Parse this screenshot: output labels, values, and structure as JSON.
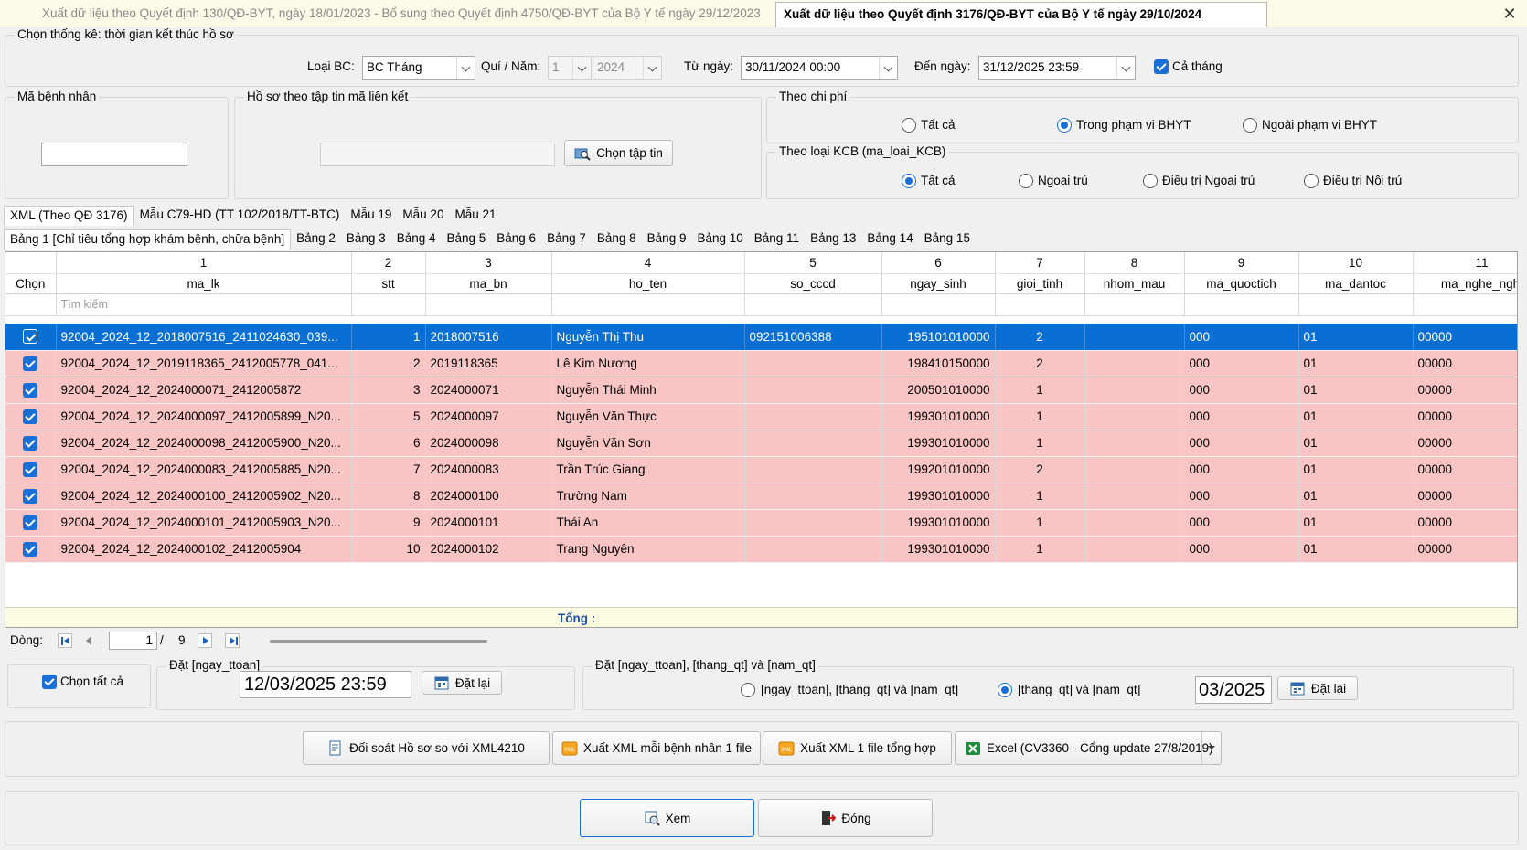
{
  "tabs": {
    "inactive": "Xuất dữ liệu theo Quyết định 130/QĐ-BYT, ngày 18/01/2023 - Bổ sung theo Quyết định 4750/QĐ-BYT của Bộ Y tế ngày 29/12/2023",
    "active": "Xuất dữ liệu theo Quyết định 3176/QĐ-BYT của Bộ Y tế ngày 29/10/2024"
  },
  "filter": {
    "group_label": "Chọn thống kê: thời gian kết thúc hồ sơ",
    "loai_bc_label": "Loại BC:",
    "loai_bc_value": "BC Tháng",
    "quy_nam_label": "Quí / Năm:",
    "quy_value": "1",
    "nam_value": "2024",
    "tu_ngay_label": "Từ ngày:",
    "tu_ngay_value": "30/11/2024 00:00",
    "den_ngay_label": "Đến ngày:",
    "den_ngay_value": "31/12/2025 23:59",
    "ca_thang_label": "Cả tháng"
  },
  "patient": {
    "label": "Mã bệnh nhân",
    "value": ""
  },
  "file_link": {
    "label": "Hồ sơ theo tập tin mã liên kết",
    "button": "Chọn tập tin"
  },
  "cost": {
    "label": "Theo chi phí",
    "options": [
      "Tất cả",
      "Trong phạm vi BHYT",
      "Ngoài phạm vi BHYT"
    ],
    "selected": 1
  },
  "kcb": {
    "label": "Theo loại KCB (ma_loai_KCB)",
    "options": [
      "Tất cả",
      "Ngoại trú",
      "Điều trị Ngoại trú",
      "Điều trị Nội trú"
    ],
    "selected": 0
  },
  "format_tabs": [
    "XML (Theo QĐ 3176)",
    "Mẫu C79-HD (TT 102/2018/TT-BTC)",
    "Mẫu 19",
    "Mẫu 20",
    "Mẫu 21"
  ],
  "table_tabs": [
    "Bảng 1 [Chỉ tiêu tổng hợp khám bệnh, chữa bệnh]",
    "Bảng 2",
    "Bảng 3",
    "Bảng 4",
    "Bảng 5",
    "Bảng 6",
    "Bảng 7",
    "Bảng 8",
    "Bảng 9",
    "Bảng 10",
    "Bảng 11",
    "Bảng 13",
    "Bảng 14",
    "Bảng 15"
  ],
  "grid": {
    "col_numbers": [
      "",
      "1",
      "2",
      "3",
      "4",
      "5",
      "6",
      "7",
      "8",
      "9",
      "10",
      "11"
    ],
    "col_names": [
      "Chọn",
      "ma_lk",
      "stt",
      "ma_bn",
      "ho_ten",
      "so_cccd",
      "ngay_sinh",
      "gioi_tinh",
      "nhom_mau",
      "ma_quoctich",
      "ma_dantoc",
      "ma_nghe_nghi"
    ],
    "search_placeholder": "Tìm kiếm",
    "rows": [
      {
        "ma_lk": "92004_2024_12_2018007516_2411024630_039...",
        "stt": "1",
        "ma_bn": "2018007516",
        "ho_ten": "Nguyễn Thị Thu",
        "so_cccd": "092151006388",
        "ngay_sinh": "195101010000",
        "gioi_tinh": "2",
        "nhom_mau": "",
        "ma_quoctich": "000",
        "ma_dantoc": "01",
        "ma_nghe": "00000"
      },
      {
        "ma_lk": "92004_2024_12_2019118365_2412005778_041...",
        "stt": "2",
        "ma_bn": "2019118365",
        "ho_ten": "Lê Kim Nương",
        "so_cccd": "",
        "ngay_sinh": "198410150000",
        "gioi_tinh": "2",
        "nhom_mau": "",
        "ma_quoctich": "000",
        "ma_dantoc": "01",
        "ma_nghe": "00000"
      },
      {
        "ma_lk": "92004_2024_12_2024000071_2412005872",
        "stt": "3",
        "ma_bn": "2024000071",
        "ho_ten": "Nguyễn Thái Minh",
        "so_cccd": "",
        "ngay_sinh": "200501010000",
        "gioi_tinh": "1",
        "nhom_mau": "",
        "ma_quoctich": "000",
        "ma_dantoc": "01",
        "ma_nghe": "00000"
      },
      {
        "ma_lk": "92004_2024_12_2024000097_2412005899_N20...",
        "stt": "5",
        "ma_bn": "2024000097",
        "ho_ten": "Nguyễn Văn Thực",
        "so_cccd": "",
        "ngay_sinh": "199301010000",
        "gioi_tinh": "1",
        "nhom_mau": "",
        "ma_quoctich": "000",
        "ma_dantoc": "01",
        "ma_nghe": "00000"
      },
      {
        "ma_lk": "92004_2024_12_2024000098_2412005900_N20...",
        "stt": "6",
        "ma_bn": "2024000098",
        "ho_ten": "Nguyễn Văn Sơn",
        "so_cccd": "",
        "ngay_sinh": "199301010000",
        "gioi_tinh": "1",
        "nhom_mau": "",
        "ma_quoctich": "000",
        "ma_dantoc": "01",
        "ma_nghe": "00000"
      },
      {
        "ma_lk": "92004_2024_12_2024000083_2412005885_N20...",
        "stt": "7",
        "ma_bn": "2024000083",
        "ho_ten": "Trần Trúc Giang",
        "so_cccd": "",
        "ngay_sinh": "199201010000",
        "gioi_tinh": "2",
        "nhom_mau": "",
        "ma_quoctich": "000",
        "ma_dantoc": "01",
        "ma_nghe": "00000"
      },
      {
        "ma_lk": "92004_2024_12_2024000100_2412005902_N20...",
        "stt": "8",
        "ma_bn": "2024000100",
        "ho_ten": "Trường Nam",
        "so_cccd": "",
        "ngay_sinh": "199301010000",
        "gioi_tinh": "1",
        "nhom_mau": "",
        "ma_quoctich": "000",
        "ma_dantoc": "01",
        "ma_nghe": "00000"
      },
      {
        "ma_lk": "92004_2024_12_2024000101_2412005903_N20...",
        "stt": "9",
        "ma_bn": "2024000101",
        "ho_ten": "Thái An",
        "so_cccd": "",
        "ngay_sinh": "199301010000",
        "gioi_tinh": "1",
        "nhom_mau": "",
        "ma_quoctich": "000",
        "ma_dantoc": "01",
        "ma_nghe": "00000"
      },
      {
        "ma_lk": "92004_2024_12_2024000102_2412005904",
        "stt": "10",
        "ma_bn": "2024000102",
        "ho_ten": "Trạng Nguyên",
        "so_cccd": "",
        "ngay_sinh": "199301010000",
        "gioi_tinh": "1",
        "nhom_mau": "",
        "ma_quoctich": "000",
        "ma_dantoc": "01",
        "ma_nghe": "00000"
      }
    ],
    "total_label": "Tổng :"
  },
  "pager": {
    "label": "Dòng:",
    "current": "1",
    "separator": "/",
    "total": "9"
  },
  "select_all": "Chọn tất cả",
  "set_ttoan": {
    "label": "Đặt [ngay_ttoan]",
    "value": "12/03/2025 23:59",
    "button": "Đặt lại"
  },
  "set_qt": {
    "label": "Đặt  [ngay_ttoan], [thang_qt] và [nam_qt]",
    "opt1": "[ngay_ttoan], [thang_qt] và [nam_qt]",
    "opt2": "[thang_qt] và [nam_qt]",
    "value": "03/2025",
    "button": "Đặt lại"
  },
  "actions": {
    "compare": "Đối soát Hồ sơ so với XML4210",
    "xml_each": "Xuất XML mỗi bệnh nhân 1 file",
    "xml_one": "Xuất XML  1 file tổng hợp",
    "excel": "Excel (CV3360 - Cổng update 27/8/2019)"
  },
  "bottom": {
    "view": "Xem",
    "close": "Đóng"
  },
  "colors": {
    "selected_row": "#0a6fd4",
    "row_pink": "#f9c4c4",
    "accent": "#1a6fd6",
    "total_bg": "#fbfbe2"
  }
}
